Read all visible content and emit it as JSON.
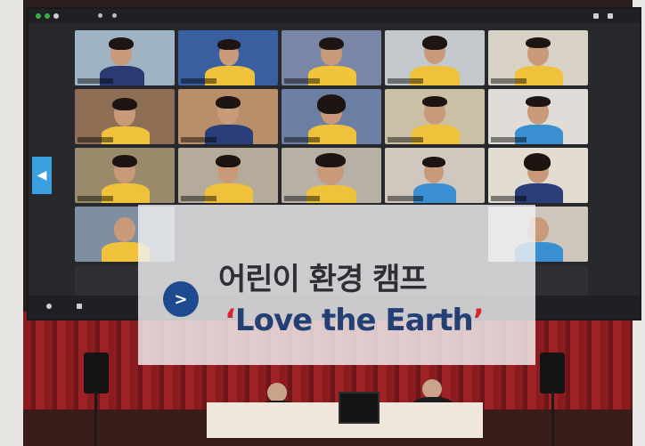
{
  "overlay": {
    "badge_icon": "chevron-right-icon",
    "badge_glyph": ">",
    "title_korean": "어린이 환경 캠프",
    "title_english_open_quote": "‘",
    "title_english": "Love the Earth",
    "title_english_close_quote": "’"
  },
  "colors": {
    "badge": "#1e4b8f",
    "title_english": "#233f73",
    "quote_marks": "#d6272f",
    "title_korean": "#2e2e33",
    "stage_curtain": "#8a1b1f",
    "nav_arrow": "#3c9fe0"
  }
}
